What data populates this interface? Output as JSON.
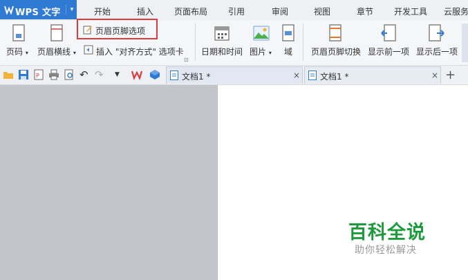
{
  "app": {
    "title": "WPS 文字",
    "accent": "#2f7bd4"
  },
  "menu": {
    "tabs": [
      "开始",
      "插入",
      "页面布局",
      "引用",
      "审阅",
      "视图",
      "章节",
      "开发工具",
      "云服务"
    ]
  },
  "ribbon": {
    "page_number": "页码",
    "header_line": "页眉横线",
    "header_footer_options": "页眉页脚选项",
    "insert_align": "插入 \"对齐方式\" 选项卡",
    "date_time": "日期和时间",
    "picture": "图片",
    "field": "域",
    "switch_header_footer": "页眉页脚切换",
    "show_previous": "显示前一项",
    "show_next": "显示后一项",
    "highlight_color": "#e0393e"
  },
  "document_tabs": [
    {
      "label": "文档1 *",
      "close": "×"
    },
    {
      "label": "文档1 *",
      "close": "×"
    }
  ],
  "new_tab": "+",
  "watermark": {
    "title": "百科全说",
    "subtitle": "助你轻松解决",
    "color": "#1c9a3c"
  }
}
